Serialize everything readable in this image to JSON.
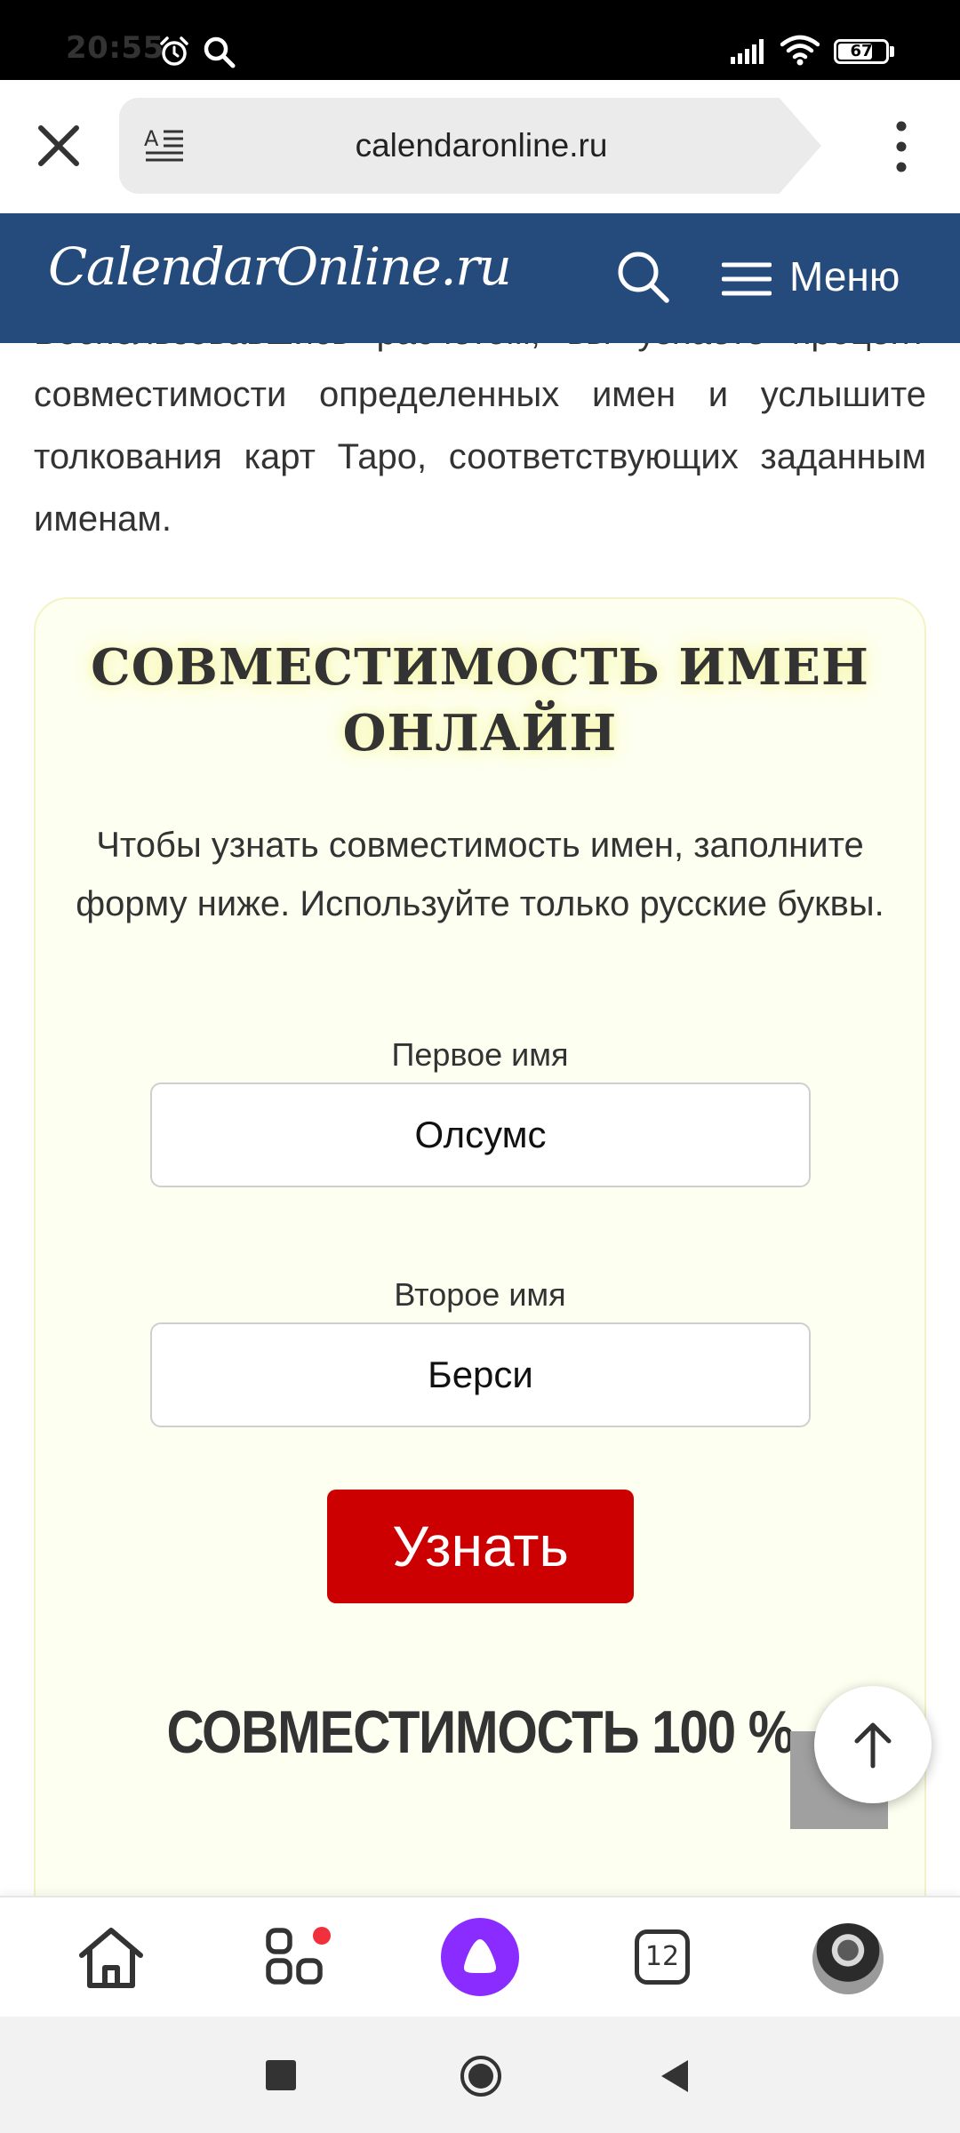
{
  "status_bar": {
    "time": "20:55",
    "battery_level": "67",
    "icons": [
      "alarm-icon",
      "search-icon",
      "signal-icon",
      "wifi-icon",
      "battery-icon"
    ]
  },
  "browser": {
    "url": "calendaronline.ru",
    "icons": [
      "close-icon",
      "reader-mode-icon",
      "more-vertical-icon"
    ]
  },
  "site_header": {
    "logo": "CalendarOnline.ru",
    "menu_label": "Меню",
    "background_color": "#244b7b"
  },
  "intro": {
    "text": "Воспользовавшись расчетом, вы узнаете процент совместимости определенных имен и услышите толкования карт Таро, соответствующих заданным именам."
  },
  "calculator": {
    "title": "СОВМЕСТИМОСТЬ ИМЕН ОНЛАЙН",
    "description": "Чтобы узнать совместимость имен, заполните форму ниже. Используйте только русские буквы.",
    "first_name_label": "Первое имя",
    "first_name_value": "Олсумс",
    "second_name_label": "Второе имя",
    "second_name_value": "Берси",
    "submit_label": "Узнать",
    "result": "СОВМЕСТИМОСТЬ 100 %",
    "submit_color": "#cc0000",
    "card_color": "#fdfff0"
  },
  "bottom_bar": {
    "tabs_count": "12",
    "icons": [
      "home-icon",
      "services-icon",
      "alice-icon",
      "tabs-icon",
      "avatar"
    ]
  },
  "nav_bar": {
    "icons": [
      "recents-icon",
      "home-circle-icon",
      "back-icon"
    ]
  }
}
